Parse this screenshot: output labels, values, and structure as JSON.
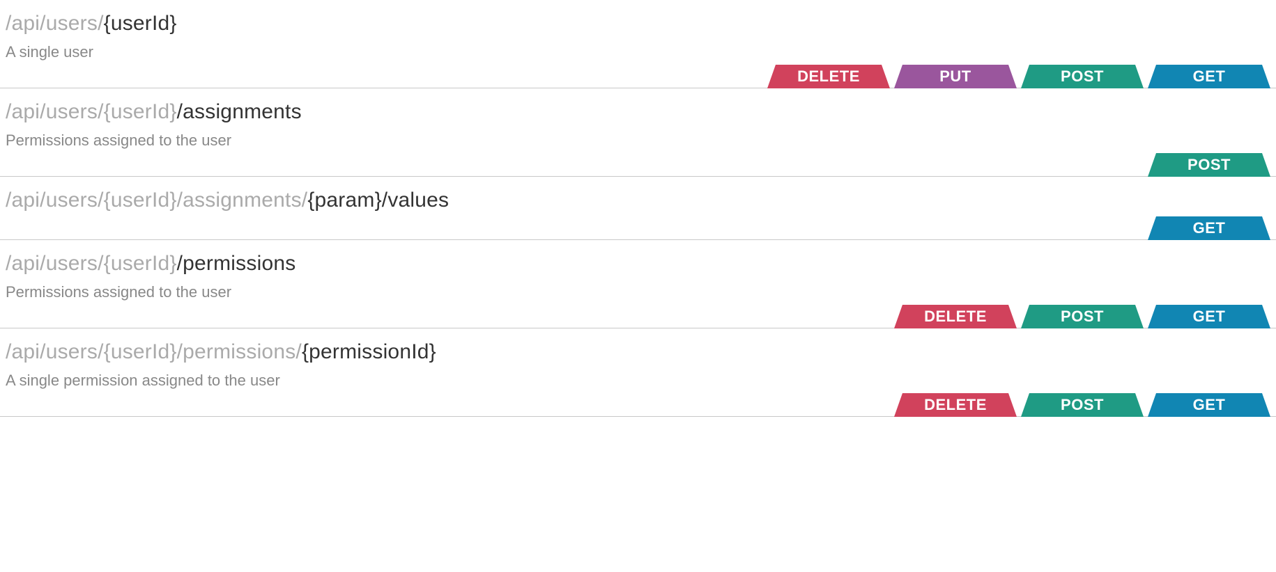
{
  "method_labels": {
    "delete": "DELETE",
    "put": "PUT",
    "post": "POST",
    "get": "GET"
  },
  "method_colors": {
    "delete": "#d1425c",
    "put": "#9a569d",
    "post": "#1f9b84",
    "get": "#1186b3"
  },
  "endpoints": [
    {
      "path_segments": [
        {
          "text": "/api/users/",
          "dim": true
        },
        {
          "text": "{userId}",
          "dim": false
        }
      ],
      "description": "A single user",
      "methods": [
        "delete",
        "put",
        "post",
        "get"
      ]
    },
    {
      "path_segments": [
        {
          "text": "/api/users/{userId}",
          "dim": true
        },
        {
          "text": "/assignments",
          "dim": false
        }
      ],
      "description": "Permissions assigned to the user",
      "methods": [
        "post"
      ]
    },
    {
      "path_segments": [
        {
          "text": "/api/users/{userId}/assignments/",
          "dim": true
        },
        {
          "text": "{param}/values",
          "dim": false
        }
      ],
      "description": "",
      "methods": [
        "get"
      ]
    },
    {
      "path_segments": [
        {
          "text": "/api/users/{userId}",
          "dim": true
        },
        {
          "text": "/permissions",
          "dim": false
        }
      ],
      "description": "Permissions assigned to the user",
      "methods": [
        "delete",
        "post",
        "get"
      ]
    },
    {
      "path_segments": [
        {
          "text": "/api/users/{userId}/permissions/",
          "dim": true
        },
        {
          "text": "{permissionId}",
          "dim": false
        }
      ],
      "description": "A single permission assigned to the user",
      "methods": [
        "delete",
        "post",
        "get"
      ]
    }
  ]
}
